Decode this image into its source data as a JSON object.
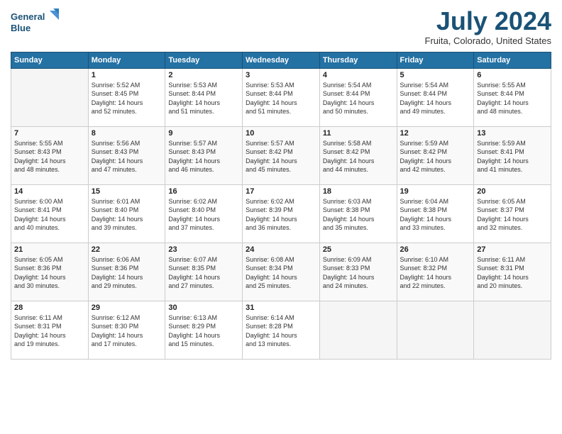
{
  "logo": {
    "line1": "General",
    "line2": "Blue"
  },
  "title": "July 2024",
  "location": "Fruita, Colorado, United States",
  "days_of_week": [
    "Sunday",
    "Monday",
    "Tuesday",
    "Wednesday",
    "Thursday",
    "Friday",
    "Saturday"
  ],
  "weeks": [
    [
      {
        "day": "",
        "content": ""
      },
      {
        "day": "1",
        "content": "Sunrise: 5:52 AM\nSunset: 8:45 PM\nDaylight: 14 hours\nand 52 minutes."
      },
      {
        "day": "2",
        "content": "Sunrise: 5:53 AM\nSunset: 8:44 PM\nDaylight: 14 hours\nand 51 minutes."
      },
      {
        "day": "3",
        "content": "Sunrise: 5:53 AM\nSunset: 8:44 PM\nDaylight: 14 hours\nand 51 minutes."
      },
      {
        "day": "4",
        "content": "Sunrise: 5:54 AM\nSunset: 8:44 PM\nDaylight: 14 hours\nand 50 minutes."
      },
      {
        "day": "5",
        "content": "Sunrise: 5:54 AM\nSunset: 8:44 PM\nDaylight: 14 hours\nand 49 minutes."
      },
      {
        "day": "6",
        "content": "Sunrise: 5:55 AM\nSunset: 8:44 PM\nDaylight: 14 hours\nand 48 minutes."
      }
    ],
    [
      {
        "day": "7",
        "content": "Sunrise: 5:55 AM\nSunset: 8:43 PM\nDaylight: 14 hours\nand 48 minutes."
      },
      {
        "day": "8",
        "content": "Sunrise: 5:56 AM\nSunset: 8:43 PM\nDaylight: 14 hours\nand 47 minutes."
      },
      {
        "day": "9",
        "content": "Sunrise: 5:57 AM\nSunset: 8:43 PM\nDaylight: 14 hours\nand 46 minutes."
      },
      {
        "day": "10",
        "content": "Sunrise: 5:57 AM\nSunset: 8:42 PM\nDaylight: 14 hours\nand 45 minutes."
      },
      {
        "day": "11",
        "content": "Sunrise: 5:58 AM\nSunset: 8:42 PM\nDaylight: 14 hours\nand 44 minutes."
      },
      {
        "day": "12",
        "content": "Sunrise: 5:59 AM\nSunset: 8:42 PM\nDaylight: 14 hours\nand 42 minutes."
      },
      {
        "day": "13",
        "content": "Sunrise: 5:59 AM\nSunset: 8:41 PM\nDaylight: 14 hours\nand 41 minutes."
      }
    ],
    [
      {
        "day": "14",
        "content": "Sunrise: 6:00 AM\nSunset: 8:41 PM\nDaylight: 14 hours\nand 40 minutes."
      },
      {
        "day": "15",
        "content": "Sunrise: 6:01 AM\nSunset: 8:40 PM\nDaylight: 14 hours\nand 39 minutes."
      },
      {
        "day": "16",
        "content": "Sunrise: 6:02 AM\nSunset: 8:40 PM\nDaylight: 14 hours\nand 37 minutes."
      },
      {
        "day": "17",
        "content": "Sunrise: 6:02 AM\nSunset: 8:39 PM\nDaylight: 14 hours\nand 36 minutes."
      },
      {
        "day": "18",
        "content": "Sunrise: 6:03 AM\nSunset: 8:38 PM\nDaylight: 14 hours\nand 35 minutes."
      },
      {
        "day": "19",
        "content": "Sunrise: 6:04 AM\nSunset: 8:38 PM\nDaylight: 14 hours\nand 33 minutes."
      },
      {
        "day": "20",
        "content": "Sunrise: 6:05 AM\nSunset: 8:37 PM\nDaylight: 14 hours\nand 32 minutes."
      }
    ],
    [
      {
        "day": "21",
        "content": "Sunrise: 6:05 AM\nSunset: 8:36 PM\nDaylight: 14 hours\nand 30 minutes."
      },
      {
        "day": "22",
        "content": "Sunrise: 6:06 AM\nSunset: 8:36 PM\nDaylight: 14 hours\nand 29 minutes."
      },
      {
        "day": "23",
        "content": "Sunrise: 6:07 AM\nSunset: 8:35 PM\nDaylight: 14 hours\nand 27 minutes."
      },
      {
        "day": "24",
        "content": "Sunrise: 6:08 AM\nSunset: 8:34 PM\nDaylight: 14 hours\nand 25 minutes."
      },
      {
        "day": "25",
        "content": "Sunrise: 6:09 AM\nSunset: 8:33 PM\nDaylight: 14 hours\nand 24 minutes."
      },
      {
        "day": "26",
        "content": "Sunrise: 6:10 AM\nSunset: 8:32 PM\nDaylight: 14 hours\nand 22 minutes."
      },
      {
        "day": "27",
        "content": "Sunrise: 6:11 AM\nSunset: 8:31 PM\nDaylight: 14 hours\nand 20 minutes."
      }
    ],
    [
      {
        "day": "28",
        "content": "Sunrise: 6:11 AM\nSunset: 8:31 PM\nDaylight: 14 hours\nand 19 minutes."
      },
      {
        "day": "29",
        "content": "Sunrise: 6:12 AM\nSunset: 8:30 PM\nDaylight: 14 hours\nand 17 minutes."
      },
      {
        "day": "30",
        "content": "Sunrise: 6:13 AM\nSunset: 8:29 PM\nDaylight: 14 hours\nand 15 minutes."
      },
      {
        "day": "31",
        "content": "Sunrise: 6:14 AM\nSunset: 8:28 PM\nDaylight: 14 hours\nand 13 minutes."
      },
      {
        "day": "",
        "content": ""
      },
      {
        "day": "",
        "content": ""
      },
      {
        "day": "",
        "content": ""
      }
    ]
  ]
}
